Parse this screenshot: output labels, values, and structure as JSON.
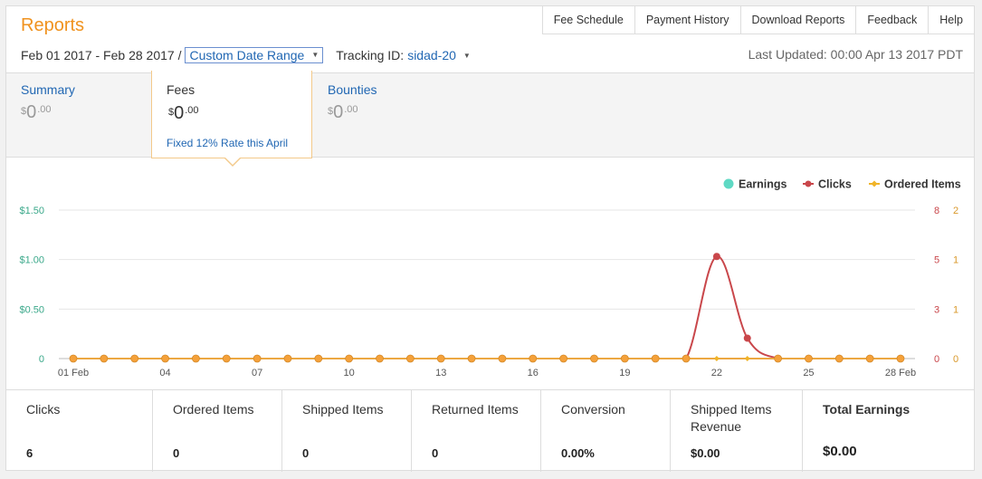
{
  "title": "Reports",
  "nav": [
    "Fee Schedule",
    "Payment History",
    "Download Reports",
    "Feedback",
    "Help"
  ],
  "date_range": "Feb 01 2017 - Feb 28 2017 /",
  "custom_range_label": "Custom Date Range",
  "tracking_label": "Tracking ID:",
  "tracking_id": "sidad-20",
  "last_updated": "Last Updated: 00:00 Apr 13 2017 PDT",
  "summary": {
    "summary_label": "Summary",
    "fees_label": "Fees",
    "bounties_label": "Bounties",
    "currency": "$",
    "whole": "0",
    "cents": ".00",
    "fees_promo": "Fixed 12% Rate this April"
  },
  "chart_data": {
    "type": "line",
    "legend_position": "top-right",
    "grid": true,
    "x": [
      "01 Feb",
      "02 Feb",
      "03 Feb",
      "04 Feb",
      "05 Feb",
      "06 Feb",
      "07 Feb",
      "08 Feb",
      "09 Feb",
      "10 Feb",
      "11 Feb",
      "12 Feb",
      "13 Feb",
      "14 Feb",
      "15 Feb",
      "16 Feb",
      "17 Feb",
      "18 Feb",
      "19 Feb",
      "20 Feb",
      "21 Feb",
      "22 Feb",
      "23 Feb",
      "24 Feb",
      "25 Feb",
      "26 Feb",
      "27 Feb",
      "28 Feb"
    ],
    "x_ticks": [
      "01 Feb",
      "04",
      "07",
      "10",
      "13",
      "16",
      "19",
      "22",
      "25",
      "28 Feb"
    ],
    "y_left_ticks": [
      "0",
      "$0.50",
      "$1.00",
      "$1.50"
    ],
    "y_left_lim": [
      0,
      1.5
    ],
    "y_clicks_ticks": [
      "0",
      "3",
      "5",
      "8"
    ],
    "y_clicks_lim": [
      0,
      8
    ],
    "y_items_ticks": [
      "0",
      "1",
      "1",
      "2"
    ],
    "y_items_lim": [
      0,
      2
    ],
    "series": [
      {
        "name": "Earnings",
        "color": "#5fd9c4",
        "values": [
          0,
          0,
          0,
          0,
          0,
          0,
          0,
          0,
          0,
          0,
          0,
          0,
          0,
          0,
          0,
          0,
          0,
          0,
          0,
          0,
          0,
          0,
          0,
          0,
          0,
          0,
          0,
          0
        ]
      },
      {
        "name": "Clicks",
        "color": "#c9474b",
        "values": [
          0,
          0,
          0,
          0,
          0,
          0,
          0,
          0,
          0,
          0,
          0,
          0,
          0,
          0,
          0,
          0,
          0,
          0,
          0,
          0,
          0,
          5.5,
          1.1,
          0,
          0,
          0,
          0,
          0
        ]
      },
      {
        "name": "Ordered Items",
        "color": "#f0b429",
        "values": [
          0,
          0,
          0,
          0,
          0,
          0,
          0,
          0,
          0,
          0,
          0,
          0,
          0,
          0,
          0,
          0,
          0,
          0,
          0,
          0,
          0,
          0,
          0,
          0,
          0,
          0,
          0,
          0
        ]
      }
    ]
  },
  "stats": [
    {
      "label": "Clicks",
      "value": "6"
    },
    {
      "label": "Ordered Items",
      "value": "0"
    },
    {
      "label": "Shipped Items",
      "value": "0"
    },
    {
      "label": "Returned Items",
      "value": "0"
    },
    {
      "label": "Conversion",
      "value": "0.00%"
    },
    {
      "label": "Shipped Items Revenue",
      "value": "$0.00"
    },
    {
      "label": "Total Earnings",
      "value": "$0.00"
    }
  ]
}
